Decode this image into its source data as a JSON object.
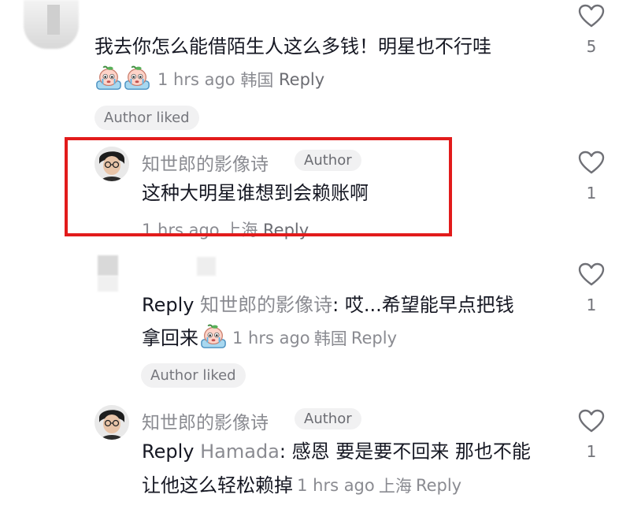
{
  "comments": [
    {
      "text": "我去你怎么能借陌生人这么多钱！明星也不行哇",
      "time": "1 hrs ago",
      "location": "韩国",
      "reply_label": "Reply",
      "likes": "5",
      "liked_badge": "Author liked",
      "emoji_name": "crying-peach-emoji"
    },
    {
      "author_name": "知世郎的影像诗",
      "author_tag": "Author",
      "text": "这种大明星谁想到会赖账啊",
      "time": "1 hrs ago",
      "location": "上海",
      "reply_label": "Reply",
      "likes": "1"
    },
    {
      "reply_prefix": "Reply",
      "reply_to": "知世郎的影像诗",
      "text_line1": ": 哎...希望能早点把钱",
      "text_line2": "拿回来",
      "time": "1 hrs ago",
      "location": "韩国",
      "reply_label": "Reply",
      "likes": "1",
      "liked_badge": "Author liked",
      "emoji_name": "crying-peach-emoji"
    },
    {
      "author_name": "知世郎的影像诗",
      "author_tag": "Author",
      "reply_prefix": "Reply",
      "reply_to": "Hamada",
      "text_line1": ": 感恩 要是要不回来 那也不能",
      "text_line2": "让他这么轻松赖掉",
      "time": "1 hrs ago",
      "location": "上海",
      "reply_label": "Reply",
      "likes": "1"
    }
  ],
  "colors": {
    "highlight": "#e21b1b",
    "muted_text": "#8a8b91",
    "primary_text": "#161823"
  }
}
